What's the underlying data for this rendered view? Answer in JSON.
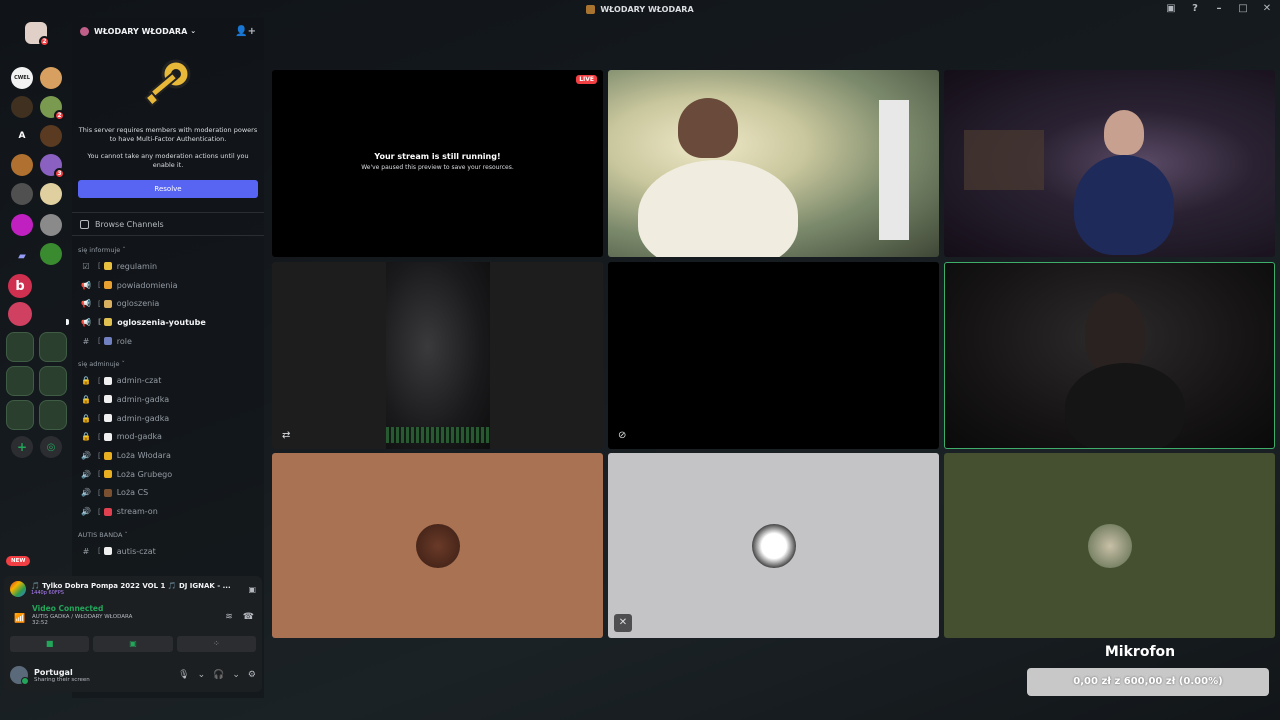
{
  "window": {
    "title": "WŁODARY WŁODARA"
  },
  "server": {
    "name": "WŁODARY WŁODARA"
  },
  "mfa_notice": {
    "line1": "This server requires members with moderation powers to have Multi-Factor Authentication.",
    "line2": "You cannot take any moderation actions until you enable it.",
    "resolve_label": "Resolve"
  },
  "browse_channels": "Browse Channels",
  "categories": [
    {
      "name": "się informuje ˇ",
      "channels": [
        {
          "name": "regulamin",
          "icon": "rules-icon",
          "emoji_color": "#e8c040",
          "active": false
        },
        {
          "name": "powiadomienia",
          "icon": "megaphone-icon",
          "emoji_color": "#e8a030",
          "active": false
        },
        {
          "name": "ogloszenia",
          "icon": "megaphone-icon",
          "emoji_color": "#d8b060",
          "active": false
        },
        {
          "name": "ogloszenia-youtube",
          "icon": "megaphone-icon",
          "emoji_color": "#e0c050",
          "active": true
        },
        {
          "name": "role",
          "icon": "hash-icon",
          "emoji_color": "#7080c0",
          "active": false
        }
      ]
    },
    {
      "name": "się adminuje ˇ",
      "channels": [
        {
          "name": "admin-czat",
          "icon": "lock-icon",
          "emoji_color": "#f0f0f0",
          "active": false
        },
        {
          "name": "admin-gadka",
          "icon": "lock-icon",
          "emoji_color": "#f0f0f0",
          "active": false
        },
        {
          "name": "admin-gadka",
          "icon": "lock-icon",
          "emoji_color": "#f0f0f0",
          "active": false
        },
        {
          "name": "mod-gadka",
          "icon": "lock-icon",
          "emoji_color": "#f0f0f0",
          "active": false
        },
        {
          "name": "Loża Włodara",
          "icon": "voice-icon",
          "emoji_color": "#e8b020",
          "active": false
        },
        {
          "name": "Loża Grubego",
          "icon": "voice-icon",
          "emoji_color": "#e8b020",
          "active": false
        },
        {
          "name": "Loża CS",
          "icon": "voice-icon",
          "emoji_color": "#7a5030",
          "active": false
        },
        {
          "name": "stream-on",
          "icon": "voice-icon",
          "emoji_color": "#e04050",
          "active": false
        }
      ]
    },
    {
      "name": "AUTIS BANDA ˇ",
      "channels": [
        {
          "name": "autis-czat",
          "icon": "hash-icon",
          "emoji_color": "#f0f0f0",
          "active": false
        }
      ]
    }
  ],
  "voice": {
    "new_badge": "NEW",
    "stream_title": "🎵 Tylko Dobra Pompa 2022 VOL 1 🎵 DJ IGNAK - ...",
    "stream_quality": "1440p 60FPS",
    "status": "Video Connected",
    "channel_path": "AUTIS GADKA / WŁODARY WŁODARA",
    "elapsed": "32:52"
  },
  "user": {
    "name": "Portugal",
    "status": "Sharing their screen"
  },
  "stream_tile": {
    "live_badge": "LIVE",
    "heading": "Your stream is still running!",
    "subtext": "We've paused this preview to save your resources."
  },
  "widget": {
    "title": "Mikrofon",
    "progress_text": "0,00 zł z 600,00 zł (0.00%)",
    "current": 0.0,
    "goal": 600.0,
    "fraction": 0.0
  },
  "colors": {
    "accent": "#5865f2",
    "live": "#f23f43",
    "connected": "#23a55a",
    "tile_avatar_1": "#a87253",
    "tile_avatar_2": "#c4c4c7",
    "tile_avatar_3": "#44502f"
  }
}
